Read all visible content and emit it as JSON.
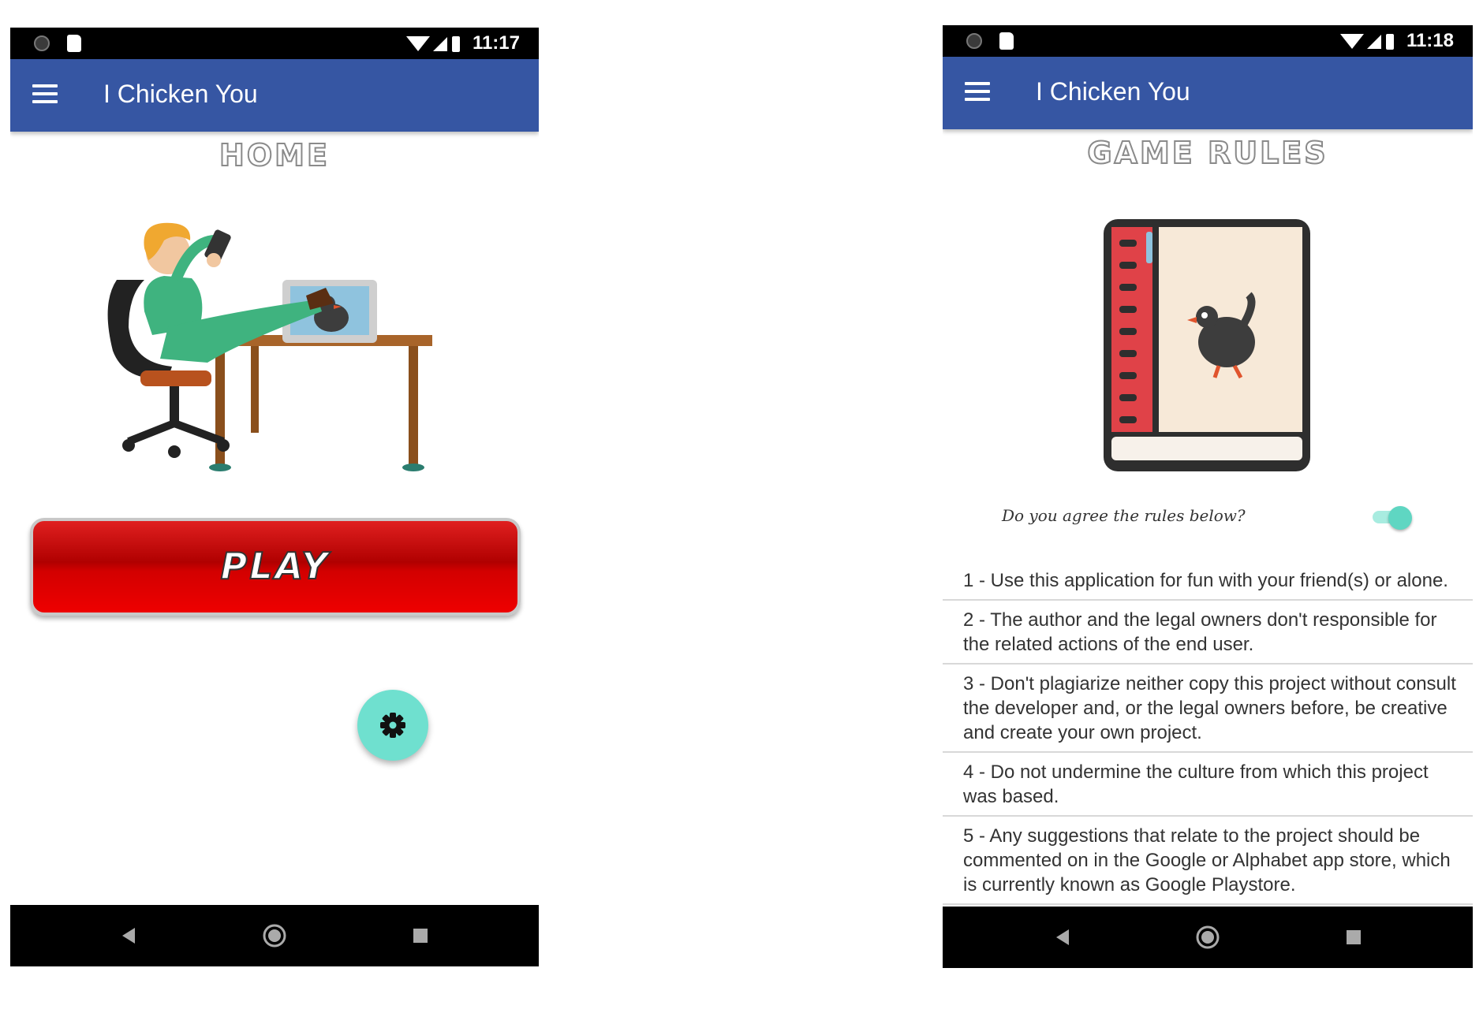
{
  "screens": {
    "home": {
      "status_bar": {
        "time": "11:17"
      },
      "app_bar": {
        "title": "I Chicken You"
      },
      "heading": "HOME",
      "play_button_label": "PLAY",
      "fab_icon": "gear-icon"
    },
    "rules": {
      "status_bar": {
        "time": "11:18"
      },
      "app_bar": {
        "title": "I Chicken You"
      },
      "heading": "GAME RULES",
      "agree_label": "Do you agree the rules below?",
      "agree_toggle_on": true,
      "rules": [
        "1 - Use this application for fun with your friend(s) or alone.",
        "2 - The author and the legal owners don't responsible for the related actions of the end user.",
        "3 - Don't plagiarize neither copy this project without consult the developer and, or the legal owners before, be creative and create your own project.",
        "4 - Do not undermine the culture from which this project was based.",
        "5 - Any suggestions that relate to the project should be commented on in the Google or Alphabet app store, which is currently known as Google Playstore."
      ]
    }
  },
  "colors": {
    "app_bar": "#3656a3",
    "fab": "#6fe0cf",
    "play_button": "#d30000",
    "toggle_on": "#5fd6c2"
  },
  "nav_icons": [
    "back-icon",
    "home-icon",
    "recents-icon"
  ]
}
